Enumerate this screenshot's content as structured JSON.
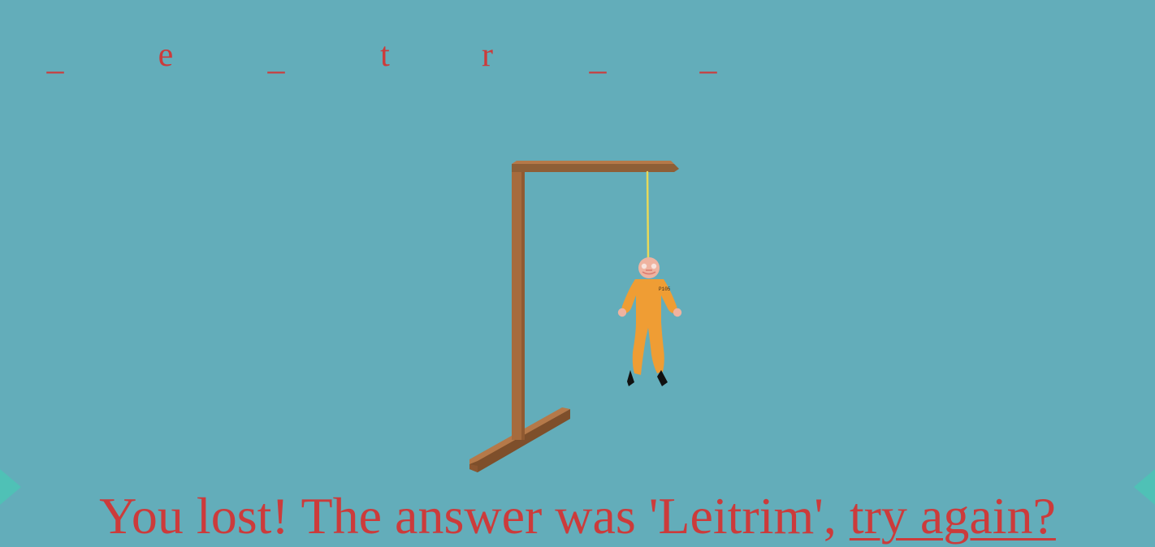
{
  "game": {
    "slots": [
      {
        "char": "_",
        "revealed": false
      },
      {
        "char": "e",
        "revealed": true
      },
      {
        "char": "_",
        "revealed": false
      },
      {
        "char": "t",
        "revealed": true
      },
      {
        "char": "r",
        "revealed": true
      },
      {
        "char": "_",
        "revealed": false
      },
      {
        "char": "_",
        "revealed": false
      }
    ],
    "prisoner_badge": "P105",
    "result_message": "You lost! The answer was 'Leitrim', ",
    "retry_label": "try again?"
  },
  "colors": {
    "background": "#63adba",
    "text": "#cc3b3b",
    "wood": "#a66b3d",
    "rope": "#e7d95a",
    "jumpsuit": "#ef9d34",
    "accent_corner": "#4fc1b6"
  },
  "icons": {
    "gallows": "gallows-icon",
    "prisoner": "hanged-prisoner-icon"
  }
}
